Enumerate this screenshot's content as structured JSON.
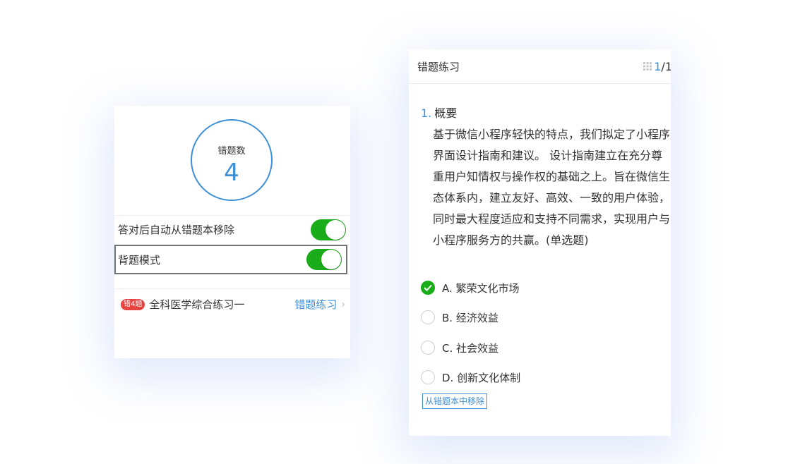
{
  "left_card": {
    "wrong_count_label": "错题数",
    "wrong_count": "4",
    "settings": {
      "auto_remove_label": "答对后自动从错题本移除",
      "auto_remove_on": true,
      "recite_mode_label": "背题模式",
      "recite_mode_on": true
    },
    "list_item": {
      "badge": "错4题",
      "title": "全科医学综合练习一",
      "action": "错题练习"
    }
  },
  "right_card": {
    "header": {
      "title": "错题练习",
      "current": "1",
      "separator": "/",
      "total": "1"
    },
    "question": {
      "number": "1.",
      "title": "概要",
      "body": "基于微信小程序轻快的特点，我们拟定了小程序界面设计指南和建议。 设计指南建立在充分尊重用户知情权与操作权的基础之上。旨在微信生态体系内，建立友好、高效、一致的用户体验，同时最大程度适应和支持不同需求，实现用户与小程序服务方的共赢。(单选题)"
    },
    "options": [
      {
        "label": "A. 繁荣文化市场",
        "selected": true
      },
      {
        "label": "B. 经济效益",
        "selected": false
      },
      {
        "label": "C. 社会效益",
        "selected": false
      },
      {
        "label": "D. 创新文化体制",
        "selected": false
      }
    ],
    "remove_button": "从错题本中移除"
  },
  "colors": {
    "accent": "#3d8fd8",
    "toggle_on": "#1aad19",
    "badge": "#e64340"
  }
}
